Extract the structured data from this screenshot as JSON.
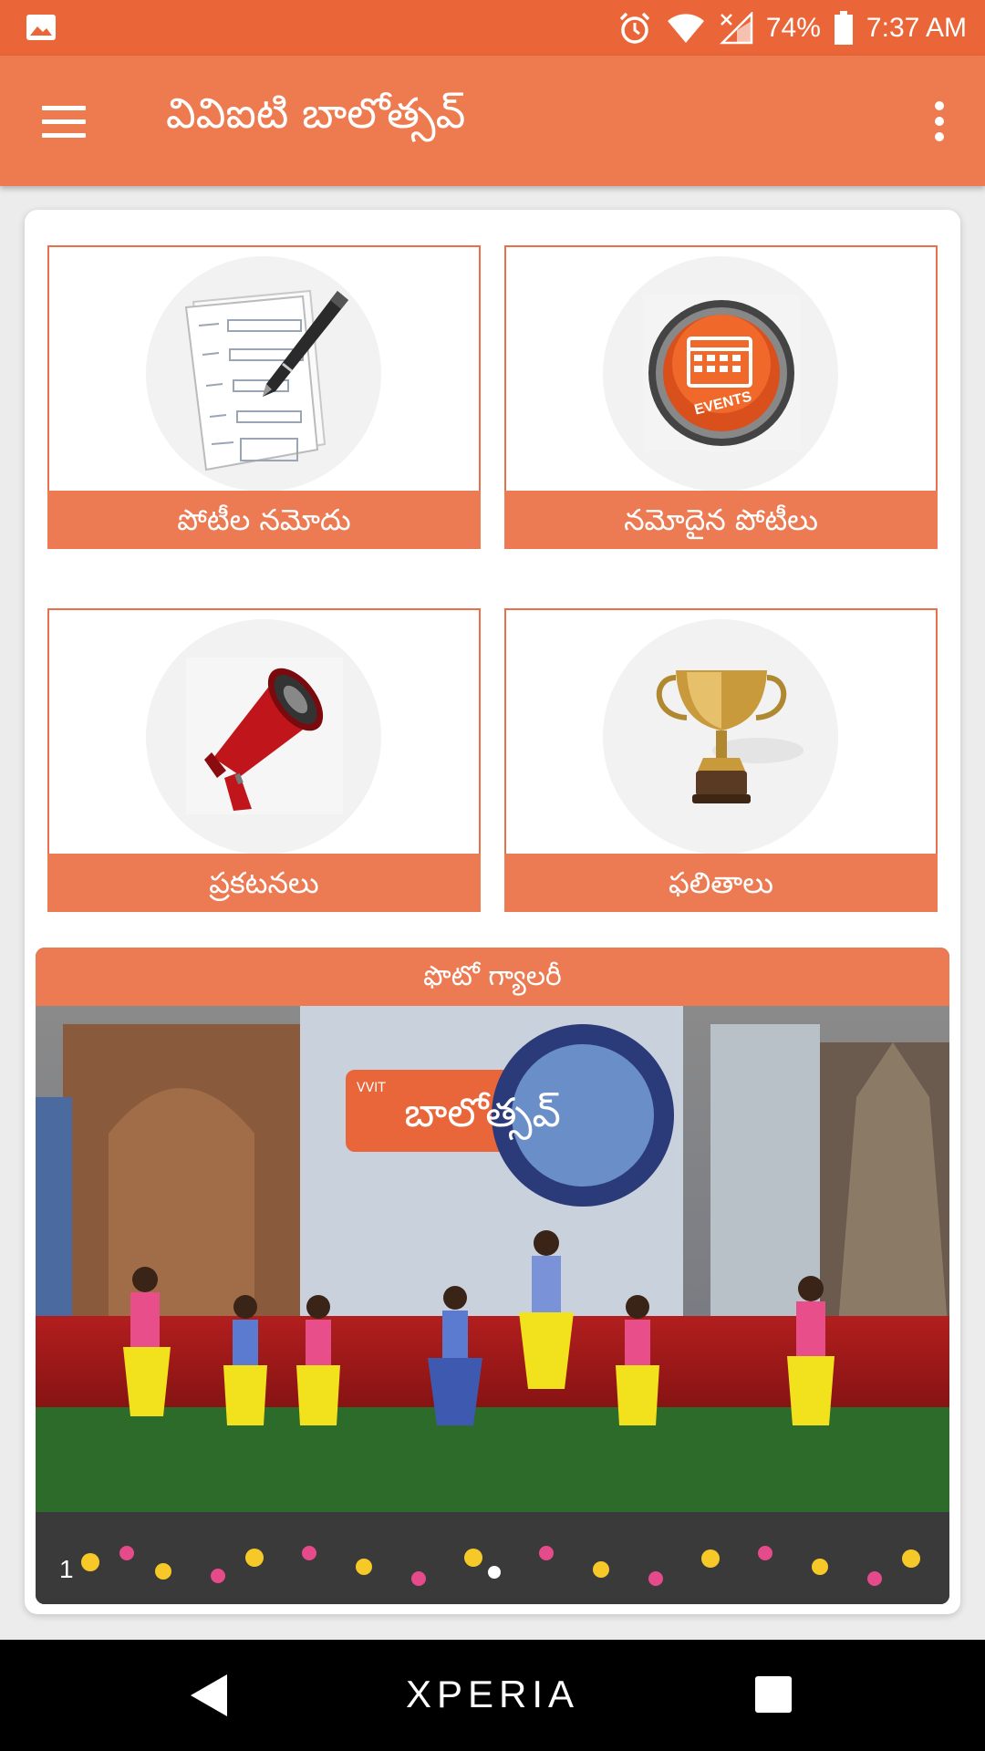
{
  "status_bar": {
    "battery": "74%",
    "time": "7:37 AM",
    "icons": [
      "image-icon",
      "alarm-icon",
      "wifi-icon",
      "signal-icon",
      "battery-icon"
    ]
  },
  "app_bar": {
    "title": "వివిఐటి బాలోత్సవ్",
    "menu_icon": "hamburger-menu-icon",
    "overflow_icon": "more-vert-icon"
  },
  "tiles": [
    {
      "label": "పోటీల నమోదు",
      "icon": "registration-form-icon"
    },
    {
      "label": "నమోదైన పోటీలు",
      "icon": "events-calendar-icon"
    },
    {
      "label": "ప్రకటనలు",
      "icon": "megaphone-icon"
    },
    {
      "label": "ఫలితాలు",
      "icon": "trophy-icon"
    }
  ],
  "gallery": {
    "title": "ఫొటో గ్యాలరీ",
    "slide_index": "1",
    "banner_brand": "VVIT",
    "banner_title": "బాలోత్సవ్"
  },
  "nav_bar": {
    "brand": "XPERIA"
  },
  "colors": {
    "status_bar": "#ea6537",
    "app_bar": "#ee7a50",
    "accent": "#ec7a52"
  }
}
